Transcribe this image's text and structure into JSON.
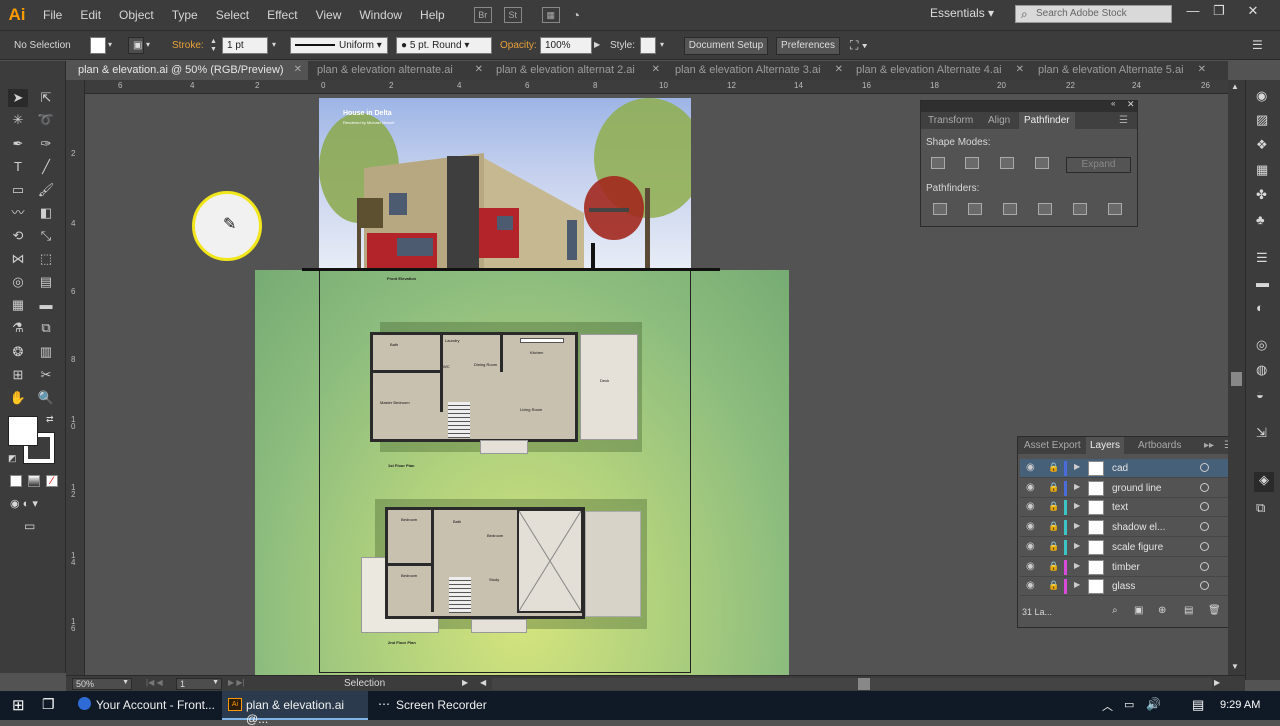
{
  "app": {
    "logo": "Ai"
  },
  "menubar": {
    "items": [
      "File",
      "Edit",
      "Object",
      "Type",
      "Select",
      "Effect",
      "View",
      "Window",
      "Help"
    ],
    "workspace": "Essentials",
    "search_placeholder": "Search Adobe Stock"
  },
  "controlbar": {
    "selection": "No Selection",
    "stroke_label": "Stroke:",
    "stroke_value": "1 pt",
    "profile": "Uniform",
    "brush": "5 pt. Round",
    "opacity_label": "Opacity:",
    "opacity_value": "100%",
    "style_label": "Style:",
    "document_setup": "Document Setup",
    "preferences": "Preferences"
  },
  "tabs": [
    {
      "label": "plan & elevation.ai @ 50% (RGB/Preview)",
      "active": true
    },
    {
      "label": "plan & elevation alternate.ai",
      "active": false
    },
    {
      "label": "plan & elevation alternat 2.ai",
      "active": false
    },
    {
      "label": "plan & elevation Alternate 3.ai",
      "active": false
    },
    {
      "label": "plan & elevation Alternate 4.ai",
      "active": false
    },
    {
      "label": "plan & elevation Alternate 5.ai",
      "active": false
    }
  ],
  "ruler_top": [
    "6",
    "4",
    "2",
    "0",
    "2",
    "4",
    "6",
    "8",
    "10",
    "12",
    "14",
    "16",
    "18",
    "20",
    "22",
    "24",
    "26"
  ],
  "ruler_left": [
    "2",
    "4",
    "6",
    "8",
    "1 0",
    "1 2",
    "1 4",
    "1 6"
  ],
  "artboard": {
    "title": "House in Delta",
    "subtitle": "Rendered by Michael Nesset",
    "elevation_caption": "Front Elevation",
    "plan1_caption": "1st Floor Plan",
    "plan2_caption": "2nd Floor Plan",
    "rooms1": [
      "Bath",
      "Laundry",
      "Kitchen",
      "WC",
      "Dining Room",
      "Deck",
      "Master Bedroom",
      "Living Room"
    ],
    "rooms2": [
      "Bedroom",
      "Bath",
      "Bedroom",
      "Bedroom",
      "Study"
    ]
  },
  "pathfinder": {
    "tabs": [
      "Transform",
      "Align",
      "Pathfinder"
    ],
    "shape_modes": "Shape Modes:",
    "pathfinders": "Pathfinders:",
    "expand": "Expand"
  },
  "layers": {
    "tabs": [
      "Asset Export",
      "Layers",
      "Artboards"
    ],
    "rows": [
      {
        "name": "cad",
        "color": "#4a6bd8",
        "selected": true
      },
      {
        "name": "ground line",
        "color": "#4a6bd8",
        "selected": false
      },
      {
        "name": "text",
        "color": "#3fc4c4",
        "selected": false
      },
      {
        "name": "shadow el...",
        "color": "#3fc4c4",
        "selected": false
      },
      {
        "name": "scale figure",
        "color": "#3fc4c4",
        "selected": false
      },
      {
        "name": "timber",
        "color": "#d84ad8",
        "selected": false
      },
      {
        "name": "glass",
        "color": "#d84ad8",
        "selected": false
      }
    ],
    "count": "31 La..."
  },
  "statusbar": {
    "zoom": "50%",
    "page": "1",
    "tool": "Selection"
  },
  "taskbar": {
    "items": [
      "Your Account - Front...",
      "plan & elevation.ai @...",
      "Screen Recorder"
    ],
    "time": "9:29 AM"
  }
}
